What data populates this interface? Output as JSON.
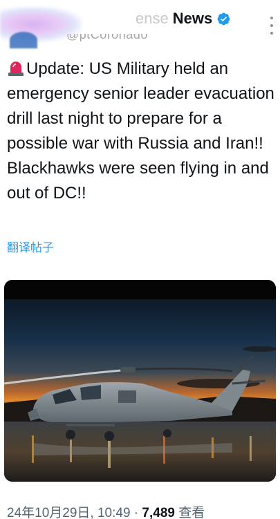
{
  "account": {
    "display_name_faded": "ense",
    "display_name": "News",
    "handle": "@ptCoronado",
    "verified": true,
    "icons": {
      "verified": "verified-badge-icon",
      "more": "more-icon"
    }
  },
  "tweet": {
    "text": "Update: US Military held an emergency senior leader evacuation drill last night to prepare for a possible war with Russia and Iran!! Blackhawks were seen flying in and out of DC!!",
    "emoji": "rotating-light-icon",
    "translate_label": "翻译帖子"
  },
  "media": {
    "alt": "helicopter-photo"
  },
  "meta": {
    "timestamp": "24年10月29日, 10:49",
    "separator": "·",
    "views_count": "7,489",
    "views_label": "查看"
  },
  "colors": {
    "accent": "#1d9bf0",
    "text": "#0f1419",
    "muted": "#536471"
  }
}
